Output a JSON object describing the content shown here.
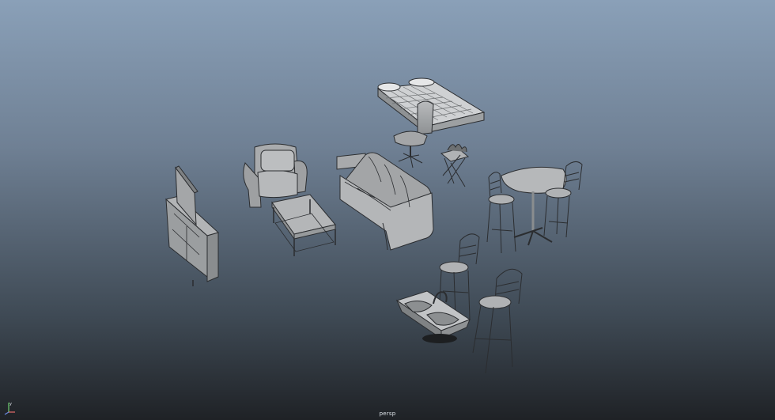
{
  "viewport": {
    "camera_label": "persp",
    "axis_labels": {
      "y": "y",
      "x": "x"
    },
    "colors": {
      "bg_top": "#8aa0b8",
      "bg_bottom": "#1f2226",
      "object_fill": "#a7a9ab",
      "object_stroke": "#2b2d30"
    }
  }
}
